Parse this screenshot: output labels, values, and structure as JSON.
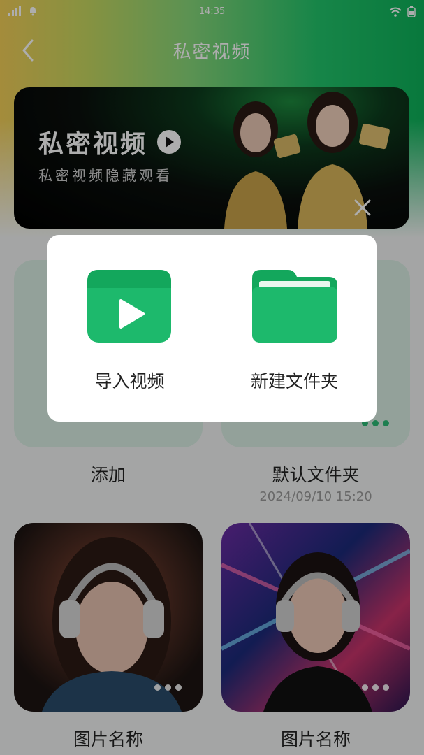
{
  "status_bar": {
    "time": "14:35"
  },
  "header": {
    "title": "私密视频",
    "back_icon": "chevron-left-icon"
  },
  "banner": {
    "title": "私密视频",
    "subtitle": "私密视频隐藏观看"
  },
  "cards": [
    {
      "label": "添加"
    },
    {
      "label": "默认文件夹",
      "date": "2024/09/10 15:20"
    },
    {
      "label": "图片名称"
    },
    {
      "label": "图片名称"
    }
  ],
  "dialog": {
    "items": [
      {
        "label": "导入视频",
        "icon": "video-play-icon"
      },
      {
        "label": "新建文件夹",
        "icon": "folder-icon"
      }
    ]
  },
  "colors": {
    "accent": "#1db96c",
    "accent_dark": "#13a75c",
    "overlay": "rgba(0,0,0,0.32)"
  }
}
